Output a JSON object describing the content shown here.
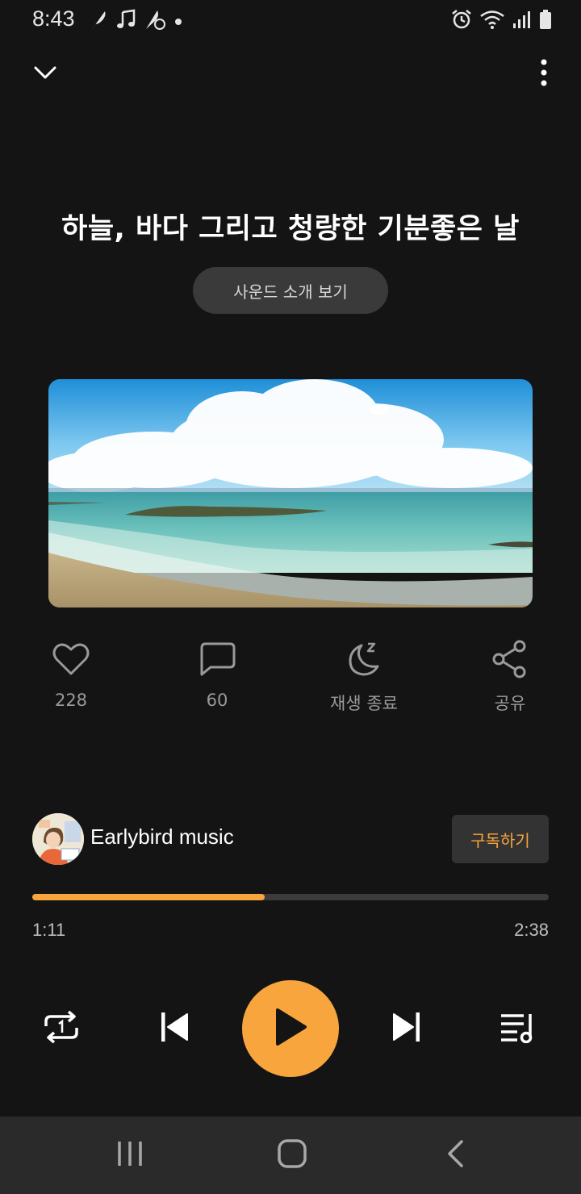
{
  "status_bar": {
    "time": "8:43",
    "left_icons": [
      "feather-icon",
      "music-note-icon",
      "app-notification-icon",
      "dot-icon"
    ],
    "right_icons": [
      "alarm-icon",
      "wifi-icon",
      "signal-icon",
      "battery-icon"
    ]
  },
  "topbar": {
    "collapse_icon": "chevron-down-icon",
    "more_icon": "more-vertical-icon"
  },
  "song": {
    "title": "하늘, 바다 그리고 청량한 기분좋은 날",
    "intro_button_label": "사운드 소개 보기"
  },
  "actions": {
    "like": {
      "icon": "heart-icon",
      "label": "228"
    },
    "comment": {
      "icon": "comment-icon",
      "label": "60"
    },
    "sleep_timer": {
      "icon": "moon-sleep-icon",
      "label": "재생 종료"
    },
    "share": {
      "icon": "share-icon",
      "label": "공유"
    }
  },
  "channel": {
    "name": "Earlybird music",
    "subscribe_label": "구독하기"
  },
  "player": {
    "elapsed": "1:11",
    "total": "2:38",
    "progress_fraction": 0.45,
    "repeat_icon": "repeat-one-icon",
    "prev_icon": "skip-previous-icon",
    "play_icon": "play-icon",
    "next_icon": "skip-next-icon",
    "playlist_icon": "playlist-icon"
  },
  "colors": {
    "accent": "#f7a53c",
    "background": "#141414",
    "button_bg": "#3a3a3a"
  },
  "navbar": {
    "icons": [
      "recent-apps-icon",
      "home-icon",
      "back-icon"
    ]
  }
}
